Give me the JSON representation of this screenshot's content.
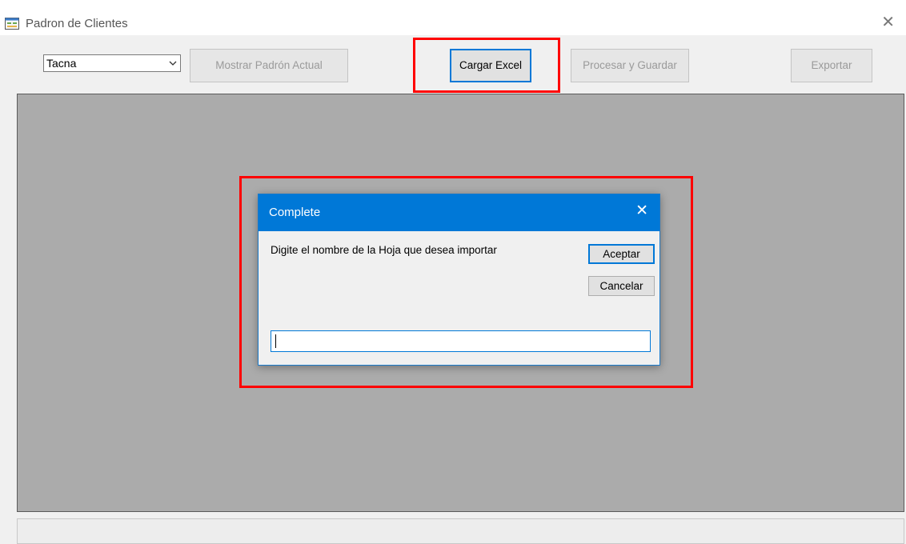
{
  "window": {
    "title": "Padron de Clientes",
    "close_glyph": "✕",
    "icon": "app-form-icon"
  },
  "toolbar": {
    "region_select": {
      "value": "Tacna"
    },
    "mostrar_label": "Mostrar Padrón Actual",
    "cargar_label": "Cargar Excel",
    "procesar_label": "Procesar y Guardar",
    "exportar_label": "Exportar"
  },
  "dialog": {
    "title": "Complete",
    "close_glyph": "✕",
    "prompt": "Digite el nombre de la Hoja que desea importar",
    "accept_label": "Aceptar",
    "cancel_label": "Cancelar",
    "input_value": ""
  },
  "colors": {
    "dialog_titlebar": "#0078d7",
    "highlight": "#ff0000",
    "grid_background": "#ababab"
  }
}
